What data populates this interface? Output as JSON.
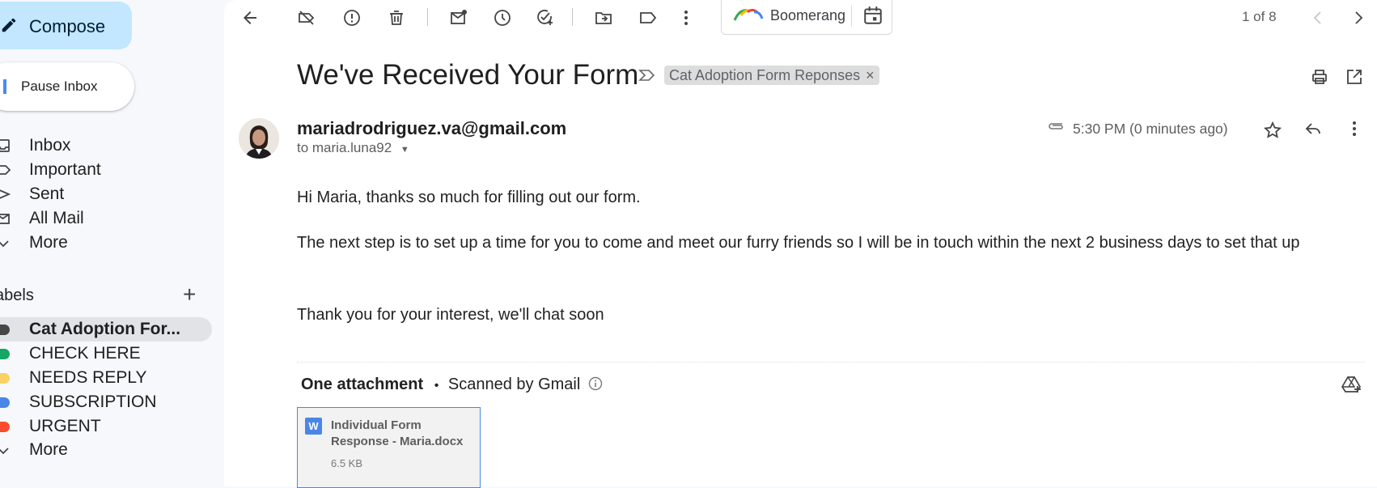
{
  "sidebar": {
    "compose_label": "Compose",
    "pause_label": "Pause Inbox",
    "nav": [
      {
        "label": "Inbox",
        "icon": "inbox-icon"
      },
      {
        "label": "Important",
        "icon": "label-important-icon"
      },
      {
        "label": "Sent",
        "icon": "send-icon"
      },
      {
        "label": "All Mail",
        "icon": "all-mail-icon"
      },
      {
        "label": "More",
        "icon": "chevron-down-icon"
      }
    ],
    "labels_heading": "abels",
    "labels": [
      {
        "label": "Cat Adoption For...",
        "color": "#444746"
      },
      {
        "label": "CHECK HERE",
        "color": "#16a765"
      },
      {
        "label": "NEEDS REPLY",
        "color": "#fad165"
      },
      {
        "label": "SUBSCRIPTION",
        "color": "#4986e7"
      },
      {
        "label": "URGENT",
        "color": "#fb4c2f"
      }
    ],
    "labels_more": "More"
  },
  "toolbar": {
    "boomerang_label": "Boomerang",
    "pager": "1 of 8"
  },
  "email": {
    "subject": "We've Received Your Form",
    "label_chip": "Cat Adoption Form Reponses",
    "label_chip_close": "×",
    "from": "mariadrodriguez.va@gmail.com",
    "to": "to maria.luna92",
    "time": "5:30 PM (0 minutes ago)",
    "body": [
      "Hi Maria, thanks so much for filling out our form.",
      "The next step is to set up a time for you to come and meet our furry friends so I will be in touch within the next 2 business days to set that up",
      "Thank you for your interest, we'll chat soon"
    ]
  },
  "attachments": {
    "heading": "One attachment",
    "bullet": "•",
    "scanned": "Scanned by Gmail",
    "items": [
      {
        "badge": "W",
        "name": "Individual Form Response - Maria.docx",
        "size": "6.5 KB"
      }
    ]
  },
  "colors": {
    "accent": "#0b57d0",
    "compose_bg": "#c2e7ff",
    "attachment_border": "#4a86e8"
  }
}
